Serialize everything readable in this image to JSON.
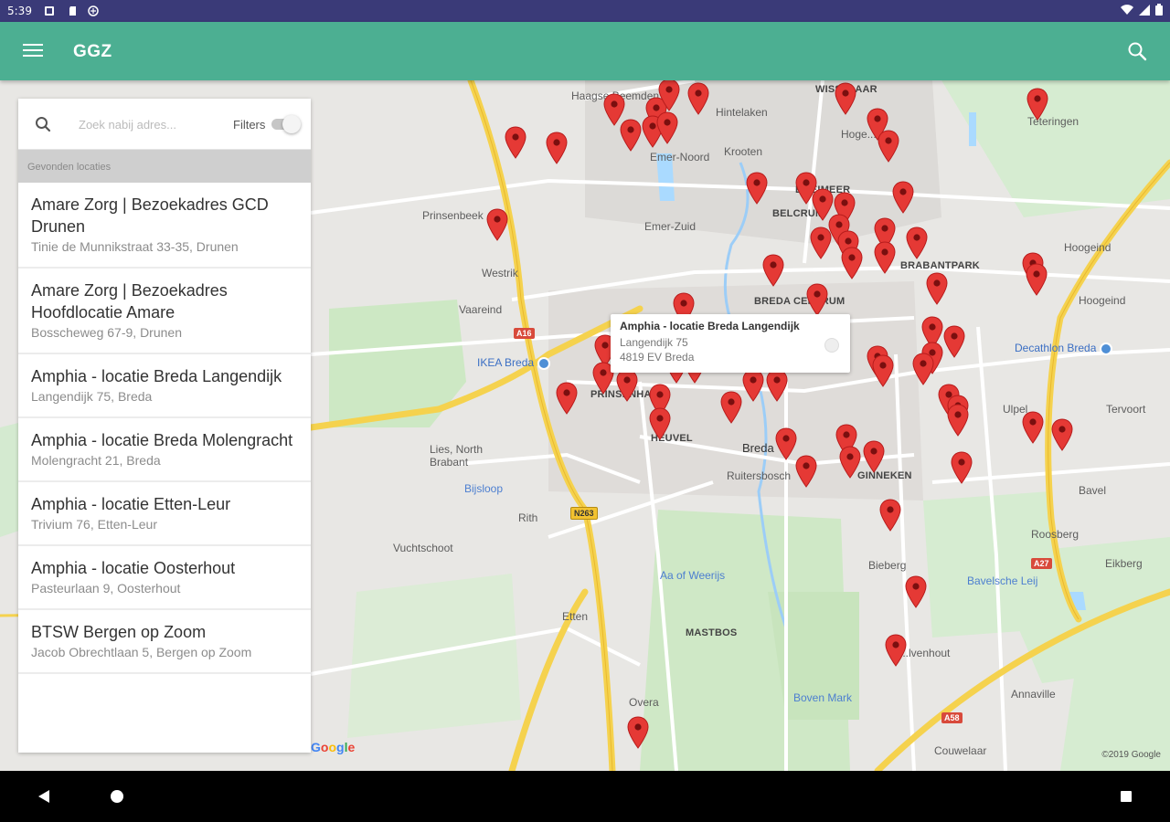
{
  "status_bar": {
    "time": "5:39"
  },
  "app_bar": {
    "title": "GGZ"
  },
  "search": {
    "placeholder": "Zoek nabij adres...",
    "filters_label": "Filters",
    "filters_enabled": false
  },
  "section_header": "Gevonden locaties",
  "locations": [
    {
      "name": "Amare Zorg | Bezoekadres GCD Drunen",
      "address": "Tinie de Munnikstraat 33-35, Drunen"
    },
    {
      "name": "Amare Zorg | Bezoekadres Hoofdlocatie Amare",
      "address": "Bosscheweg 67-9, Drunen"
    },
    {
      "name": "Amphia - locatie Breda Langendijk",
      "address": "Langendijk 75, Breda"
    },
    {
      "name": "Amphia - locatie Breda Molengracht",
      "address": "Molengracht 21, Breda"
    },
    {
      "name": "Amphia - locatie Etten-Leur",
      "address": "Trivium 76, Etten-Leur"
    },
    {
      "name": "Amphia - locatie Oosterhout",
      "address": "Pasteurlaan 9, Oosterhout"
    },
    {
      "name": "BTSW Bergen op Zoom",
      "address": "Jacob Obrechtlaan 5, Bergen op Zoom"
    }
  ],
  "info_window": {
    "title": "Amphia - locatie Breda Langendijk",
    "line1": "Langendijk 75",
    "line2": "4819 EV Breda"
  },
  "map": {
    "places": [
      "Haagse Beemden",
      "Hintelaken",
      "Emer-Noord",
      "Krooten",
      "Teteringen",
      "Hoge...",
      "BOEIMEER",
      "BELCRUM",
      "Prinsenbeek",
      "Emer-Zuid",
      "Hoogeind",
      "Westrik",
      "BRABANTPARK",
      "Vaareind",
      "BREDA CENTRUM",
      "Hoogeind",
      "IKEA Breda",
      "Decathlon Breda",
      "PRINSENHAGE",
      "GINNEKEN",
      "Ulpel",
      "Tervoort",
      "Lies, North Brabant",
      "Breda",
      "Ruitersbosch",
      "Bavel",
      "Bijsloop",
      "Rith",
      "Vuchtschoot",
      "Roosberg",
      "Aa of Weerijs",
      "Bieberg",
      "Eikberg",
      "Bavelsche Leij",
      "Etten",
      "MASTBOS",
      "Overa",
      "Boven Mark",
      "Annaville",
      "Couwelaar",
      "HEUVEL",
      "WISSELAAR",
      "...lvenhout"
    ],
    "shields": [
      "A16",
      "N263",
      "A16",
      "A27",
      "A58"
    ],
    "copyright": "©2019 Google",
    "logo": "Google"
  },
  "colors": {
    "status_bar": "#3a3a78",
    "app_bar": "#4caf92",
    "pin": "#e53935",
    "section_bg": "#cfcfcf"
  }
}
